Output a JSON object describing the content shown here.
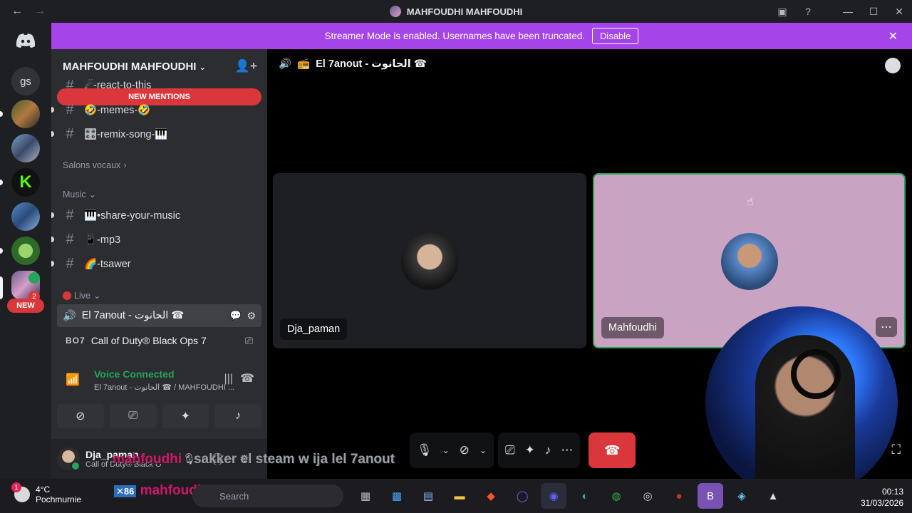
{
  "window": {
    "title": "MAHFOUDHI MAHFOUDHI"
  },
  "banner": {
    "text": "Streamer Mode is enabled. Usernames have been truncated.",
    "button": "Disable"
  },
  "rail": {
    "text_server": "gs",
    "new_badge": "NEW",
    "mention_count": "2"
  },
  "sidebar": {
    "server_name": "MAHFOUDHI MAHFOUDHI",
    "new_mentions": "NEW MENTIONS",
    "channels_top": [
      {
        "name": "☄-react-to-this"
      },
      {
        "name": "🤣-memes-🤣"
      },
      {
        "name": "🎛️-remix-song-🎹"
      }
    ],
    "category_voice": "Salons vocaux",
    "category_music": "Music",
    "channels_music": [
      {
        "name": "🎹•share-your-music"
      },
      {
        "name": "📱-mp3"
      },
      {
        "name": "🌈-tsawer"
      }
    ],
    "category_live": "Live",
    "live_channel": "El 7anout - الحانوت ☎"
  },
  "activity": {
    "game_tag": "BO7",
    "game": "Call of Duty® Black Ops 7"
  },
  "voice": {
    "status": "Voice Connected",
    "location": "El 7anout - الحانوت ☎ / MAHFOUDHI ..."
  },
  "user": {
    "name": "Dja_paman",
    "status": "Call of Duty® Black O"
  },
  "call": {
    "channel": "El 7anout - الحانوت ☎",
    "participants": [
      {
        "name": "Dja_paman"
      },
      {
        "name": "Mahfoudhi"
      }
    ]
  },
  "overlay": {
    "username": "mahfoudhi",
    "message": " : sakker el steam w ija lel 7anout",
    "username2": "mahfoudhi"
  },
  "taskbar": {
    "temp": "4°C",
    "location": "Pochmurnie",
    "weather_badge": "1",
    "search": "Search",
    "time": "00:13",
    "date": "31/03/2026"
  },
  "colors": {
    "banner": "#a544e8",
    "sidebar": "#2b2d31",
    "accent_green": "#23a55a",
    "danger": "#da373c",
    "active_tile": "#c9a3c2",
    "inactive_tile": "#1e1f22"
  }
}
